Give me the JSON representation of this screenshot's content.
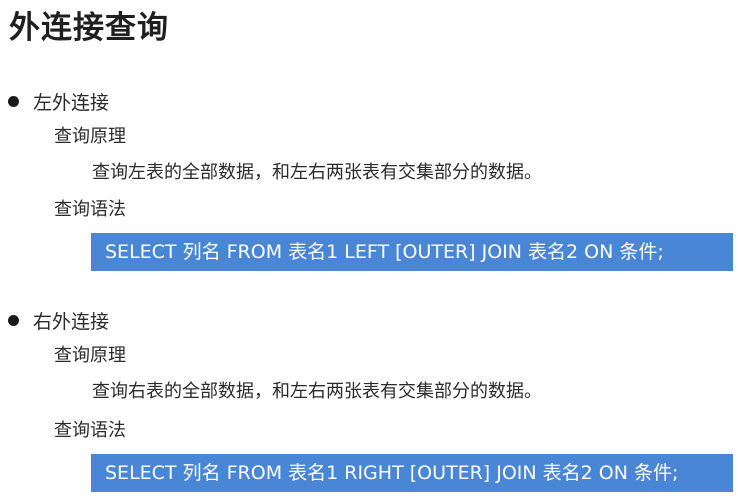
{
  "page": {
    "title": "外连接查询"
  },
  "sections": [
    {
      "heading": "左外连接",
      "principle_label": "查询原理",
      "principle_text": "查询左表的全部数据，和左右两张表有交集部分的数据。",
      "syntax_label": "查询语法",
      "syntax_code": "SELECT 列名 FROM 表名1 LEFT [OUTER] JOIN 表名2 ON 条件;"
    },
    {
      "heading": "右外连接",
      "principle_label": "查询原理",
      "principle_text": "查询右表的全部数据，和左右两张表有交集部分的数据。",
      "syntax_label": "查询语法",
      "syntax_code": "SELECT 列名 FROM 表名1 RIGHT [OUTER] JOIN 表名2 ON 条件;"
    }
  ],
  "colors": {
    "code_background": "#4a86d6",
    "code_text": "#ffffff",
    "text": "#2b2b2b"
  }
}
